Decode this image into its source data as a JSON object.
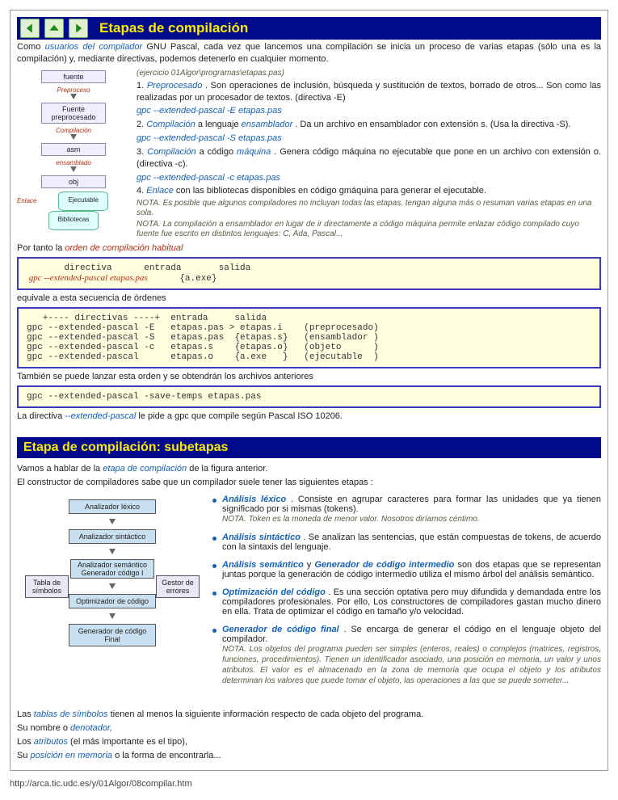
{
  "nav": {
    "title": "Etapas de compilación"
  },
  "intro": {
    "pre": "Como ",
    "em": "usuarios del compilador",
    "post": " GNU Pascal, cada vez que lancemos una compilación se inicia un proceso de varias etapas (sólo una es la compilación) y, mediante directivas, podemos detenerlo en cualquier momento."
  },
  "exercise": "(ejercicio 01Algor\\programas\\etapas.pas)",
  "stages": {
    "s1": {
      "n": "1. ",
      "t": "Preprocesado",
      "rest": " . Son operaciones de inclusión, búsqueda y sustitución de textos, borrado de otros... Son como las realizadas por un procesador de textos.  (directiva -E)",
      "cmd": " gpc --extended-pascal -E etapas.pas"
    },
    "s2": {
      "n": "2. ",
      "t": "Compilación",
      "mid": "  a lenguaje ",
      "t2": "ensamblador",
      "rest": " . Da un archivo en ensamblador con extensión s. (Usa la directiva -S).",
      "cmd": " gpc --extended-pascal -S etapas.pas"
    },
    "s3": {
      "n": "3. ",
      "t": "Compilación",
      "mid": "  a código ",
      "t2": "máquina",
      "rest": " . Genera código máquina no ejecutable que pone en un archivo con extensión o. (directiva -c).",
      "cmd": " gpc --extended-pascal -c etapas.pas"
    },
    "s4": {
      "n": "4. ",
      "t": "Enlace",
      "rest": "  con las bibliotecas disponibles en código gmáquina para generar el ejecutable."
    },
    "note1": "NOTA. Es posible que algunos compiladores no incluyan todas las etapas, tengan alguna más o resuman varias etapas en una sola.",
    "note2": "NOTA. La compilación a ensamblador en lugar de ir directamente a código máquina permite enlazar código compilado cuyo fuente fue escrito en distintos lenguajes: C, Ada, Pascal..."
  },
  "por_tanto": {
    "pre": "Por tanto la  ",
    "em": "orden de compilación habitual"
  },
  "code1": {
    "hdr": "       directiva      entrada       salida",
    "line": " gpc --extended-pascal etapas.pas",
    "out": "{a.exe}"
  },
  "equiv": "equivale a esta secuencia de órdenes",
  "code2": "   +---- directivas ----+  entrada     salida\ngpc --extended-pascal -E   etapas.pas > etapas.i    (preprocesado)\ngpc --extended-pascal -S   etapas.pas  {etapas.s}   (ensamblador )\ngpc --extended-pascal -c   etapas.s    {etapas.o}   (objeto      )\ngpc --extended-pascal      etapas.o    {a.exe   }   (ejecutable  )",
  "tambien": "También se puede lanzar esta orden y se obtendrán los archivos anteriores",
  "code3": "gpc --extended-pascal -save-temps etapas.pas",
  "directiva": {
    "pre": "La directiva  ",
    "em": "--extended-pascal",
    "post": "  le pide a gpc que compile según Pascal ISO 10206."
  },
  "sec2": "Etapa de compilación: subetapas",
  "vamos": {
    "pre": "Vamos a hablar de la  ",
    "em": "etapa de compilación",
    "post": "  de la   figura anterior."
  },
  "constructor": "El constructor de compiladores sabe que un compilador suele tener las siguientes etapas :",
  "fig": {
    "b1": "Analizador léxico",
    "b2": "Analizador sintáctico",
    "b3": "Analizador semántico",
    "b4": "Generador código I",
    "b5": "Optimizador de código",
    "b6": "Generador de código Final",
    "left": "Tabla de símbolos",
    "right": "Gestor de errores"
  },
  "bul": {
    "b1": {
      "t": "Análisis léxico",
      "rest": " . Consiste en agrupar caracteres para formar las unidades que ya tienen significado por si mismas (tokens).",
      "note": "NOTA. Token es la moneda de menor valor. Nosotros diríamos céntimo."
    },
    "b2": {
      "t": "Análisis  sintáctico",
      "rest": " . Se analizan las sentencias, que están compuestas de tokens, de acuerdo con la sintaxis del lenguaje."
    },
    "b3": {
      "t1": "Análisis   semántico",
      "mid": "  y  ",
      "t2": "Generador  de  código  intermedio",
      "rest": "  son  dos  etapas  que  se representan juntas porque la generación de código intermedio utiliza el mismo árbol del análisis semántico."
    },
    "b4": {
      "t": "Optimización del código",
      "rest": " . Es una sección optativa pero muy difundida y demandada entre los compiladores profesionales. Por ello, Los constructores de compiladores gastan mucho dinero en ella. Trata de optimizar el código en tamaño y/o velocidad."
    },
    "b5": {
      "t": "Generador de código final",
      "rest": " . Se encarga de generar el código en el lenguaje objeto del compilador.",
      "note": "NOTA. Los objetos del programa pueden ser simples (enteros, reales) o complejos (matrices, registros, funciones, procedimientos). Tienen un identificador asociado, una posición en memoria, un valor y unos atributos. El valor es el almacenado en la zona de memoria que ocupa el objeto y los atributos determinan los valores que puede tomar el objeto, las operaciones a las que se puede someter..."
    }
  },
  "tablas": {
    "pre": "Las  ",
    "em": "tablas de símbolos",
    "post": "  tienen al menos la siguiente información respecto de cada objeto del programa."
  },
  "li1": {
    "pre": " Su nombre o  ",
    "em": "denotador,"
  },
  "li2": {
    "pre": " Los  ",
    "em": "atributos",
    "post": "  (el más importante es el tipo),"
  },
  "li3": {
    "pre": " Su  ",
    "em": "posición en memoria",
    "post": "  o la forma de encontrarla..."
  },
  "url": "http://arca.tic.udc.es/y/01Algor/08compilar.htm"
}
